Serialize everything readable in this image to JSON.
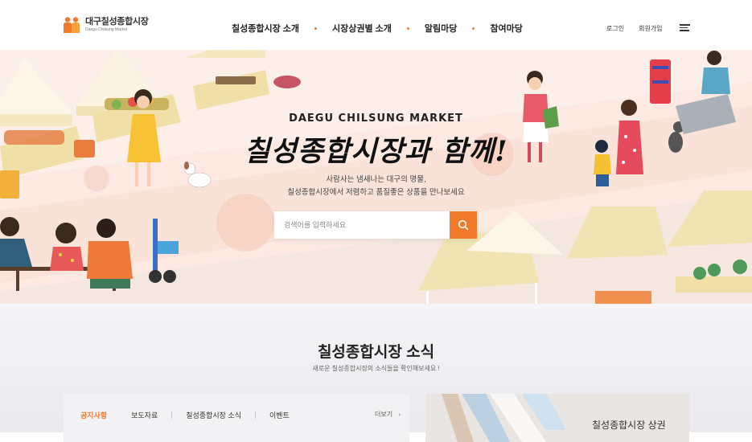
{
  "header": {
    "logo_name": "대구칠성종합시장",
    "logo_sub": "Daegu Chilsung Market",
    "nav": [
      "칠성종합시장 소개",
      "시장상권별 소개",
      "알림마당",
      "참여마당"
    ],
    "login": "로그인",
    "signup": "회원가입"
  },
  "hero": {
    "eyebrow": "DAEGU CHILSUNG MARKET",
    "title": "칠성종합시장과 함께!",
    "desc_line1": "사람사는 냄새나는 대구의 명물,",
    "desc_line2": "칠성종합시장에서 저렴하고 품질좋은 상품을 만나보세요",
    "search_placeholder": "검색어를 입력하세요"
  },
  "news": {
    "title": "칠성종합시장 소식",
    "subtitle": "새로운 칠성종합시장의 소식들을 확인해보세요 !",
    "tabs": [
      "공지사항",
      "보도자료",
      "칠성종합시장 소식",
      "이벤트"
    ],
    "more": "더보기",
    "promo_title": "칠성종합시장 상권"
  },
  "colors": {
    "accent": "#f07a2a",
    "hero_bg": "#fbe9e2"
  }
}
